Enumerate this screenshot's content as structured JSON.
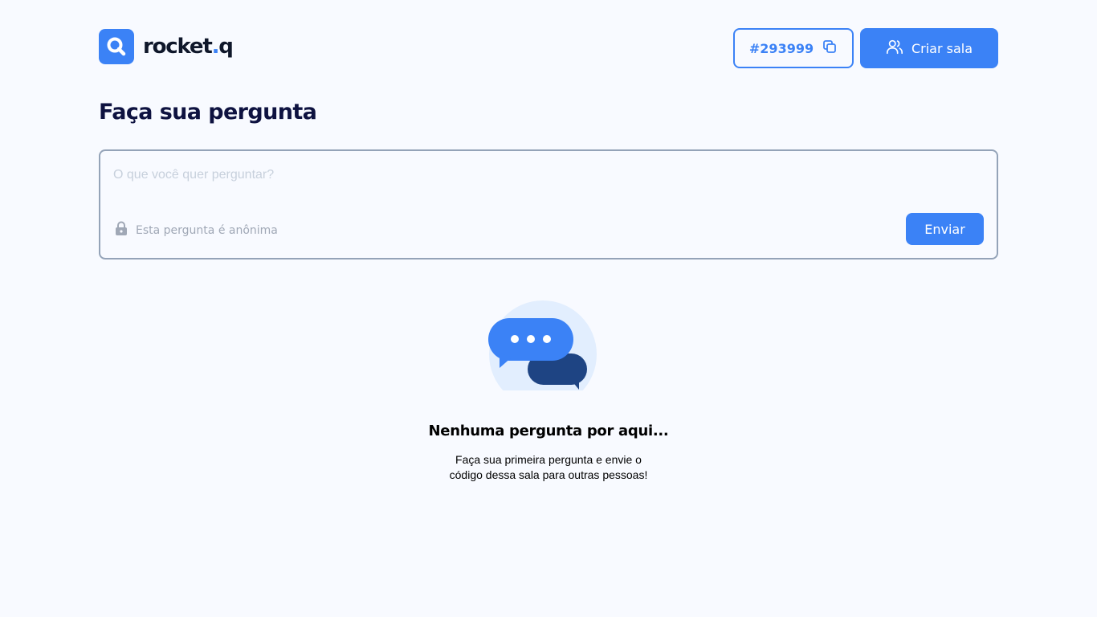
{
  "header": {
    "logo_text_main": "rocket",
    "logo_text_dot": ".",
    "logo_text_end": "q",
    "room_code": "#293999",
    "create_room_label": "Criar sala"
  },
  "page": {
    "title": "Faça sua pergunta"
  },
  "question_form": {
    "placeholder": "O que você quer perguntar?",
    "anonymous_label": "Esta pergunta é anônima",
    "send_label": "Enviar"
  },
  "empty_state": {
    "title": "Nenhuma pergunta por aqui...",
    "text": "Faça sua primeira pergunta e envie o código dessa sala para outras pessoas!"
  },
  "icons": {
    "logo": "logo-search-icon",
    "copy": "copy-icon",
    "users": "users-icon",
    "lock": "lock-icon",
    "chat": "chat-bubbles-icon"
  },
  "colors": {
    "accent": "#3B82F6",
    "title": "#0E1240",
    "background": "#F8FAFF",
    "border": "#94A3B8"
  }
}
